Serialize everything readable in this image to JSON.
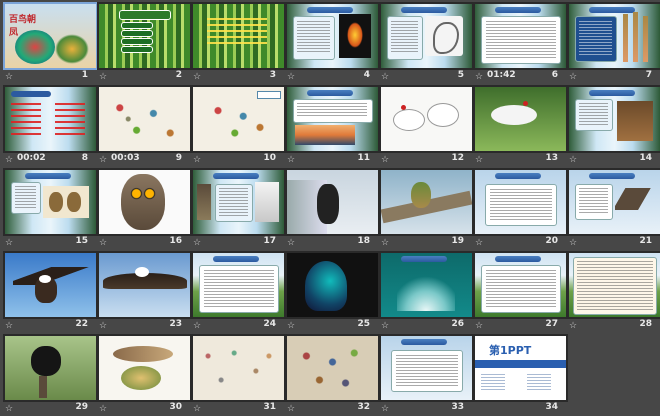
{
  "slides": [
    {
      "number": "1",
      "title": "百鸟朝凤",
      "timing": ""
    },
    {
      "number": "2",
      "title": "",
      "timing": ""
    },
    {
      "number": "3",
      "title": "",
      "timing": ""
    },
    {
      "number": "4",
      "title": "",
      "timing": ""
    },
    {
      "number": "5",
      "title": "",
      "timing": ""
    },
    {
      "number": "6",
      "title": "",
      "timing": "01:42"
    },
    {
      "number": "7",
      "title": "",
      "timing": ""
    },
    {
      "number": "8",
      "title": "",
      "timing": "00:02"
    },
    {
      "number": "9",
      "title": "",
      "timing": "00:03"
    },
    {
      "number": "10",
      "title": "",
      "timing": ""
    },
    {
      "number": "11",
      "title": "",
      "timing": ""
    },
    {
      "number": "12",
      "title": "",
      "timing": ""
    },
    {
      "number": "13",
      "title": "",
      "timing": ""
    },
    {
      "number": "14",
      "title": "",
      "timing": ""
    },
    {
      "number": "15",
      "title": "",
      "timing": ""
    },
    {
      "number": "16",
      "title": "",
      "timing": ""
    },
    {
      "number": "17",
      "title": "",
      "timing": ""
    },
    {
      "number": "18",
      "title": "",
      "timing": ""
    },
    {
      "number": "19",
      "title": "",
      "timing": ""
    },
    {
      "number": "20",
      "title": "",
      "timing": ""
    },
    {
      "number": "21",
      "title": "",
      "timing": ""
    },
    {
      "number": "22",
      "title": "",
      "timing": ""
    },
    {
      "number": "23",
      "title": "",
      "timing": ""
    },
    {
      "number": "24",
      "title": "",
      "timing": ""
    },
    {
      "number": "25",
      "title": "",
      "timing": ""
    },
    {
      "number": "26",
      "title": "",
      "timing": ""
    },
    {
      "number": "27",
      "title": "",
      "timing": ""
    },
    {
      "number": "28",
      "title": "",
      "timing": ""
    },
    {
      "number": "29",
      "title": "",
      "timing": ""
    },
    {
      "number": "30",
      "title": "",
      "timing": ""
    },
    {
      "number": "31",
      "title": "",
      "timing": ""
    },
    {
      "number": "32",
      "title": "",
      "timing": ""
    },
    {
      "number": "33",
      "title": "",
      "timing": ""
    },
    {
      "number": "34",
      "title": "第1PPT",
      "timing": ""
    }
  ],
  "colors": {
    "background": "#474747",
    "selected_border": "#7ba4d9"
  }
}
